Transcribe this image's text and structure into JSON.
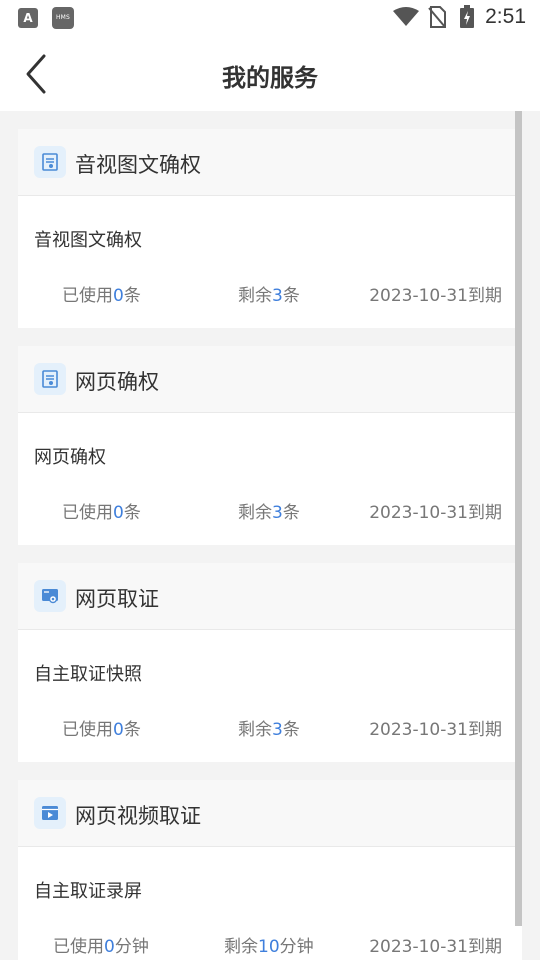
{
  "status_bar": {
    "time": "2:51",
    "app_icon_letter": "A",
    "hms_label": "HMS"
  },
  "header": {
    "title": "我的服务",
    "back_icon": "chevron-left-icon"
  },
  "colors": {
    "accent": "#3f7fdc",
    "icon_bg": "#e4f0fb"
  },
  "cards": [
    {
      "title": "音视图文确权",
      "icon": "document-icon",
      "item": "音视图文确权",
      "used_prefix": "已使用",
      "used": "0",
      "used_unit": "条",
      "left_prefix": "剩余",
      "left": "3",
      "left_unit": "条",
      "expire": "2023-10-31到期"
    },
    {
      "title": "网页确权",
      "icon": "document-icon",
      "item": "网页确权",
      "used_prefix": "已使用",
      "used": "0",
      "used_unit": "条",
      "left_prefix": "剩余",
      "left": "3",
      "left_unit": "条",
      "expire": "2023-10-31到期"
    },
    {
      "title": "网页取证",
      "icon": "webpage-evidence-icon",
      "item": "自主取证快照",
      "used_prefix": "已使用",
      "used": "0",
      "used_unit": "条",
      "left_prefix": "剩余",
      "left": "3",
      "left_unit": "条",
      "expire": "2023-10-31到期"
    },
    {
      "title": "网页视频取证",
      "icon": "video-window-icon",
      "item": "自主取证录屏",
      "used_prefix": "已使用",
      "used": "0",
      "used_unit": "分钟",
      "left_prefix": "剩余",
      "left": "10",
      "left_unit": "分钟",
      "expire": "2023-10-31到期"
    }
  ]
}
